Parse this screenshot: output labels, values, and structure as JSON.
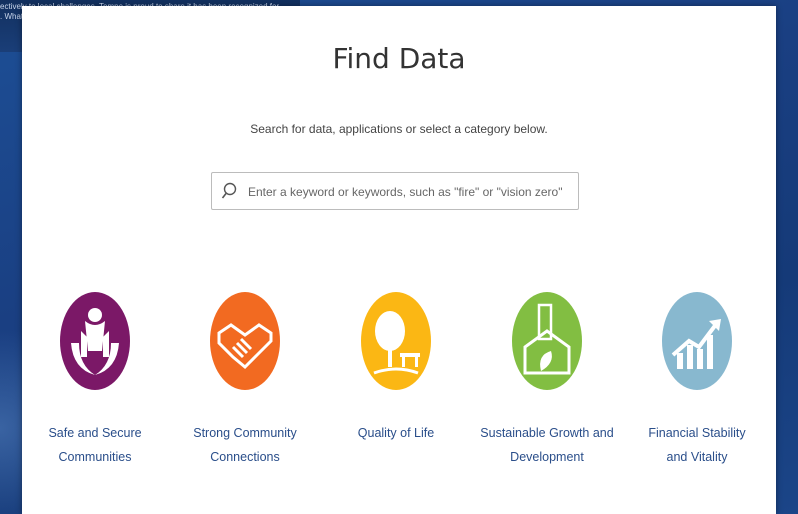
{
  "background": {
    "lines": [
      "ectively to local challenges, Tempe is proud to share it has been recognized for",
      ". What"
    ]
  },
  "modal": {
    "title": "Find Data",
    "subtitle": "Search for data, applications or select a category below.",
    "search": {
      "placeholder": "Enter a keyword or keywords, such as \"fire\" or \"vision zero\"",
      "icon": "search-icon"
    },
    "categories": [
      {
        "label_line1": "Safe and Secure",
        "label_line2": "Communities",
        "color": "#7b1867",
        "icon": "people-hands-icon"
      },
      {
        "label_line1": "Strong Community",
        "label_line2": "Connections",
        "color": "#f26a21",
        "icon": "handshake-icon"
      },
      {
        "label_line1": "Quality of Life",
        "label_line2": "",
        "color": "#fbb714",
        "icon": "tree-bench-icon"
      },
      {
        "label_line1": "Sustainable Growth and",
        "label_line2": "Development",
        "color": "#82be42",
        "icon": "house-building-leaf-icon"
      },
      {
        "label_line1": "Financial Stability",
        "label_line2": "and Vitality",
        "color": "#88b8cf",
        "icon": "rising-chart-icon"
      }
    ]
  }
}
